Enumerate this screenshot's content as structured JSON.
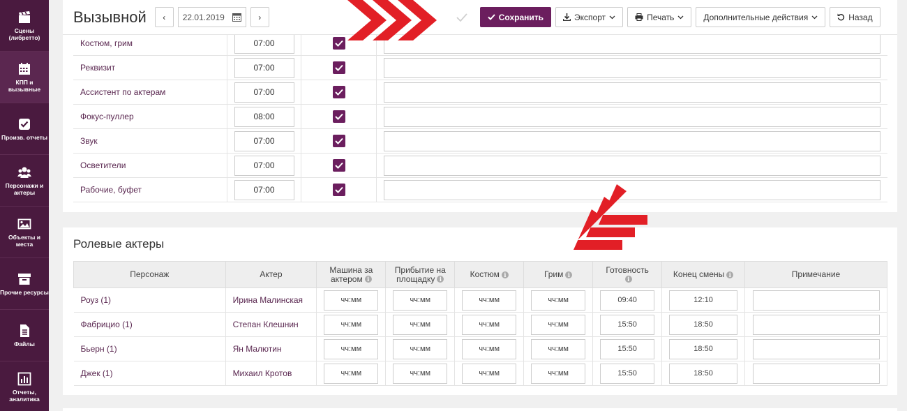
{
  "sidebar": {
    "items": [
      {
        "label": "Сцены (либретто)",
        "icon": "clapperboard-icon"
      },
      {
        "label": "КПП и вызывные",
        "icon": "calendar-icon"
      },
      {
        "label": "Произв. отчеты",
        "icon": "checkbox-icon"
      },
      {
        "label": "Персонажи и актеры",
        "icon": "users-icon"
      },
      {
        "label": "Объекты и места",
        "icon": "image-icon"
      },
      {
        "label": "Прочие ресурсы",
        "icon": "archive-icon"
      },
      {
        "label": "Файлы",
        "icon": "file-icon"
      },
      {
        "label": "Отчеты, аналитика",
        "icon": "bar-chart-icon"
      }
    ]
  },
  "header": {
    "title": "Вызывной",
    "date": "22.01.2019",
    "prev": "‹",
    "next": "›",
    "save_label": "Сохранить",
    "export_label": "Экспорт",
    "print_label": "Печать",
    "more_label": "Дополнительные действия",
    "back_label": "Назад"
  },
  "crew": {
    "rows": [
      {
        "dept": "Костюм, грим",
        "time": "07:00",
        "checked": true
      },
      {
        "dept": "Реквизит",
        "time": "07:00",
        "checked": true
      },
      {
        "dept": "Ассистент по актерам",
        "time": "07:00",
        "checked": true
      },
      {
        "dept": "Фокус-пуллер",
        "time": "08:00",
        "checked": true
      },
      {
        "dept": "Звук",
        "time": "07:00",
        "checked": true
      },
      {
        "dept": "Осветители",
        "time": "07:00",
        "checked": true
      },
      {
        "dept": "Рабочие, буфет",
        "time": "07:00",
        "checked": true
      }
    ]
  },
  "actors": {
    "title": "Ролевые актеры",
    "columns": [
      "Персонаж",
      "Актер",
      "Машина за актером",
      "Прибытие на площадку",
      "Костюм",
      "Грим",
      "Готовность",
      "Конец смены",
      "Примечание"
    ],
    "placeholder": "чч:мм",
    "rows": [
      {
        "character": "Роуз (1)",
        "actor": "Ирина Малинская",
        "car": "",
        "arrival": "",
        "costume": "",
        "makeup": "",
        "ready": "09:40",
        "end": "12:10"
      },
      {
        "character": "Фабрицио (1)",
        "actor": "Степан Клешнин",
        "car": "",
        "arrival": "",
        "costume": "",
        "makeup": "",
        "ready": "15:50",
        "end": "18:50"
      },
      {
        "character": "Бьерн (1)",
        "actor": "Ян Малютин",
        "car": "",
        "arrival": "",
        "costume": "",
        "makeup": "",
        "ready": "15:50",
        "end": "18:50"
      },
      {
        "character": "Джек (1)",
        "actor": "Михаил Кротов",
        "car": "",
        "arrival": "",
        "costume": "",
        "makeup": "",
        "ready": "15:50",
        "end": "18:50"
      }
    ]
  },
  "colors": {
    "accent": "#6b1e5e",
    "sidebar": "#4a1a3f",
    "arrow": "#e21f26"
  }
}
